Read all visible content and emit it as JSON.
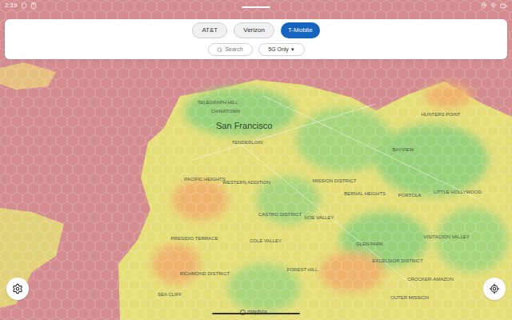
{
  "status_bar": {
    "time": "2:19"
  },
  "carrier_tabs": [
    {
      "label": "AT&T",
      "selected": false
    },
    {
      "label": "Verizon",
      "selected": false
    },
    {
      "label": "T-Mobile",
      "selected": true
    }
  ],
  "search": {
    "placeholder": "Search"
  },
  "filter": {
    "label": "5G Only",
    "arrow": "▾"
  },
  "map": {
    "city": "San Francisco",
    "labels": [
      "TELEGRAPH HILL",
      "CHINATOWN",
      "TENDERLOIN",
      "PACIFIC HEIGHTS",
      "WESTERN ADDITION",
      "MISSION DISTRICT",
      "CASTRO DISTRICT",
      "NOE VALLEY",
      "COLE VALLEY",
      "PRESIDIO TERRACE",
      "RICHMOND DISTRICT",
      "SEA CLIFF",
      "FOREST HILL",
      "BAYVIEW",
      "HUNTERS POINT",
      "PORTOLA",
      "LITTLE HOLLYWOOD",
      "BERNAL HEIGHTS",
      "VISITACION VALLEY",
      "GLEN PARK",
      "EXCELSIOR DISTRICT",
      "CROCKER-AMAZON",
      "OUTER MISSION"
    ],
    "attribution": "mapbox"
  }
}
